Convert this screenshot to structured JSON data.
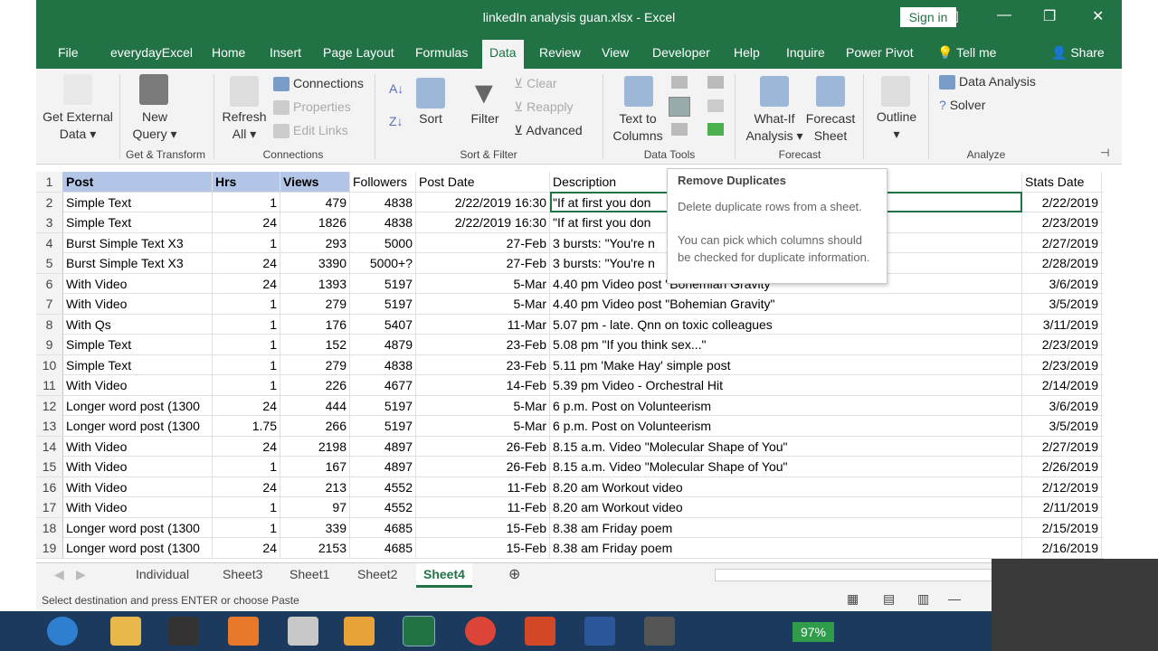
{
  "window": {
    "title": "linkedIn analysis guan.xlsx  -  Excel",
    "sign_in": "Sign in"
  },
  "tabs": [
    "File",
    "everydayExcel",
    "Home",
    "Insert",
    "Page Layout",
    "Formulas",
    "Data",
    "Review",
    "View",
    "Developer",
    "Help",
    "Inquire",
    "Power Pivot",
    "Tell me",
    "Share"
  ],
  "ribbon": {
    "get_external": "Get External",
    "get_external2": "Data ▾",
    "new_query": "New",
    "new_query2": "Query ▾",
    "refresh": "Refresh",
    "refresh2": "All ▾",
    "connections": "Connections",
    "properties": "Properties",
    "edit_links": "Edit Links",
    "sort": "Sort",
    "filter": "Filter",
    "clear": "Clear",
    "reapply": "Reapply",
    "advanced": "Advanced",
    "text_to": "Text to",
    "columns": "Columns",
    "whatif": "What-If",
    "analysis": "Analysis ▾",
    "forecast": "Forecast",
    "sheet": "Sheet",
    "outline": "Outline",
    "data_analysis": "Data Analysis",
    "solver": "Solver",
    "groups": [
      "Get & Transform",
      "Connections",
      "Sort & Filter",
      "Data Tools",
      "Forecast",
      "Analyze"
    ]
  },
  "tooltip": {
    "title": "Remove Duplicates",
    "line1": "Delete duplicate rows from a sheet.",
    "line2": "You can pick which columns should be checked for duplicate information."
  },
  "headers": [
    "Post",
    "Hrs",
    "Views",
    "Followers",
    "Post Date",
    "Description",
    "Stats Date"
  ],
  "rows": [
    [
      "2",
      "Simple Text",
      "1",
      "479",
      "4838",
      "2/22/2019 16:30",
      "\"If at first you don",
      "2/22/2019"
    ],
    [
      "3",
      "Simple Text",
      "24",
      "1826",
      "4838",
      "2/22/2019 16:30",
      "\"If at first you don",
      "2/23/2019"
    ],
    [
      "4",
      "Burst Simple Text X3",
      "1",
      "293",
      "5000",
      "27-Feb",
      "3 bursts: \"You're n",
      "2/27/2019"
    ],
    [
      "5",
      "Burst Simple Text X3",
      "24",
      "3390",
      "5000+?",
      "27-Feb",
      "3 bursts: \"You're n",
      "2/28/2019"
    ],
    [
      "6",
      "With Video",
      "24",
      "1393",
      "5197",
      "5-Mar",
      "4.40 pm Video post \"Bohemian Gravity\"",
      "3/6/2019"
    ],
    [
      "7",
      "With Video",
      "1",
      "279",
      "5197",
      "5-Mar",
      "4.40 pm Video post \"Bohemian Gravity\"",
      "3/5/2019"
    ],
    [
      "8",
      "With Qs",
      "1",
      "176",
      "5407",
      "11-Mar",
      "5.07 pm - late. Qnn on toxic colleagues",
      "3/11/2019"
    ],
    [
      "9",
      "Simple Text",
      "1",
      "152",
      "4879",
      "23-Feb",
      "5.08 pm \"If you think sex...\"",
      "2/23/2019"
    ],
    [
      "10",
      "Simple Text",
      "1",
      "279",
      "4838",
      "23-Feb",
      "5.11 pm 'Make Hay' simple post",
      "2/23/2019"
    ],
    [
      "11",
      "With Video",
      "1",
      "226",
      "4677",
      "14-Feb",
      "5.39 pm Video - Orchestral Hit",
      "2/14/2019"
    ],
    [
      "12",
      "Longer word post (1300",
      "24",
      "444",
      "5197",
      "5-Mar",
      "6 p.m. Post on Volunteerism",
      "3/6/2019"
    ],
    [
      "13",
      "Longer word post (1300",
      "1.75",
      "266",
      "5197",
      "5-Mar",
      "6 p.m. Post on Volunteerism",
      "3/5/2019"
    ],
    [
      "14",
      "With Video",
      "24",
      "2198",
      "4897",
      "26-Feb",
      "8.15 a.m. Video \"Molecular Shape of You\"",
      "2/27/2019"
    ],
    [
      "15",
      "With Video",
      "1",
      "167",
      "4897",
      "26-Feb",
      "8.15 a.m. Video \"Molecular Shape of You\"",
      "2/26/2019"
    ],
    [
      "16",
      "With Video",
      "24",
      "213",
      "4552",
      "11-Feb",
      "8.20 am Workout video",
      "2/12/2019"
    ],
    [
      "17",
      "With Video",
      "1",
      "97",
      "4552",
      "11-Feb",
      "8.20 am Workout video",
      "2/11/2019"
    ],
    [
      "18",
      "Longer word post (1300",
      "1",
      "339",
      "4685",
      "15-Feb",
      "8.38 am Friday poem",
      "2/15/2019"
    ],
    [
      "19",
      "Longer word post (1300",
      "24",
      "2153",
      "4685",
      "15-Feb",
      "8.38 am Friday poem",
      "2/16/2019"
    ]
  ],
  "sheets": [
    "Individual",
    "Sheet3",
    "Sheet1",
    "Sheet2",
    "Sheet4"
  ],
  "status": "Select destination and press ENTER or choose Paste",
  "battery": "97%",
  "colors": {
    "accent": "#217346"
  }
}
